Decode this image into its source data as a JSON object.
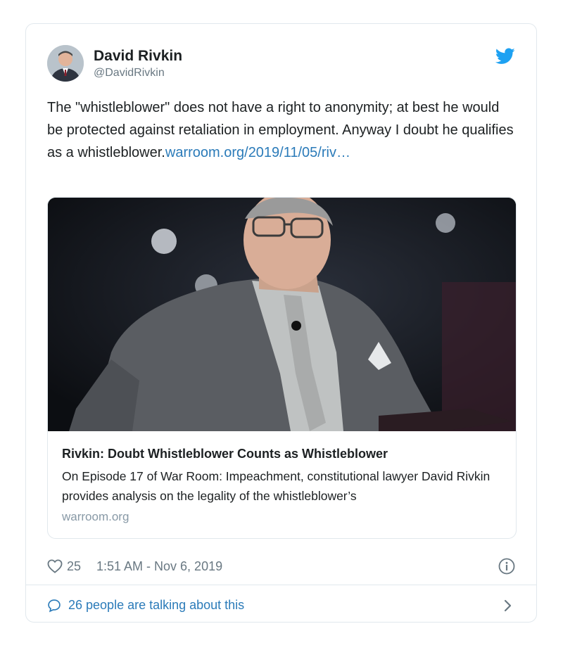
{
  "tweet": {
    "author": {
      "name": "David Rivkin",
      "handle": "@DavidRivkin",
      "avatar_icon": "avatar-photo"
    },
    "brand_icon": "twitter-bird-icon",
    "brand_color": "#1da1f2",
    "text": "The \"whistleblower\" does not have a right to anonymity; at best he would be protected against retaliation in employment. Anyway I doubt he qualifies as a whistleblower.",
    "link_text": "warroom.org/2019/11/05/riv…",
    "link_color": "#2b7bb9",
    "card": {
      "title": "Rivkin: Doubt Whistleblower Counts as Whistleblower",
      "description": "On Episode 17 of War Room: Impeachment, constitutional lawyer David Rivkin provides analysis on the legality of the whistleblower’s",
      "domain": "warroom.org"
    },
    "likes": "25",
    "timestamp": "1:51 AM - Nov 6, 2019",
    "talking": "26 people are talking about this"
  }
}
